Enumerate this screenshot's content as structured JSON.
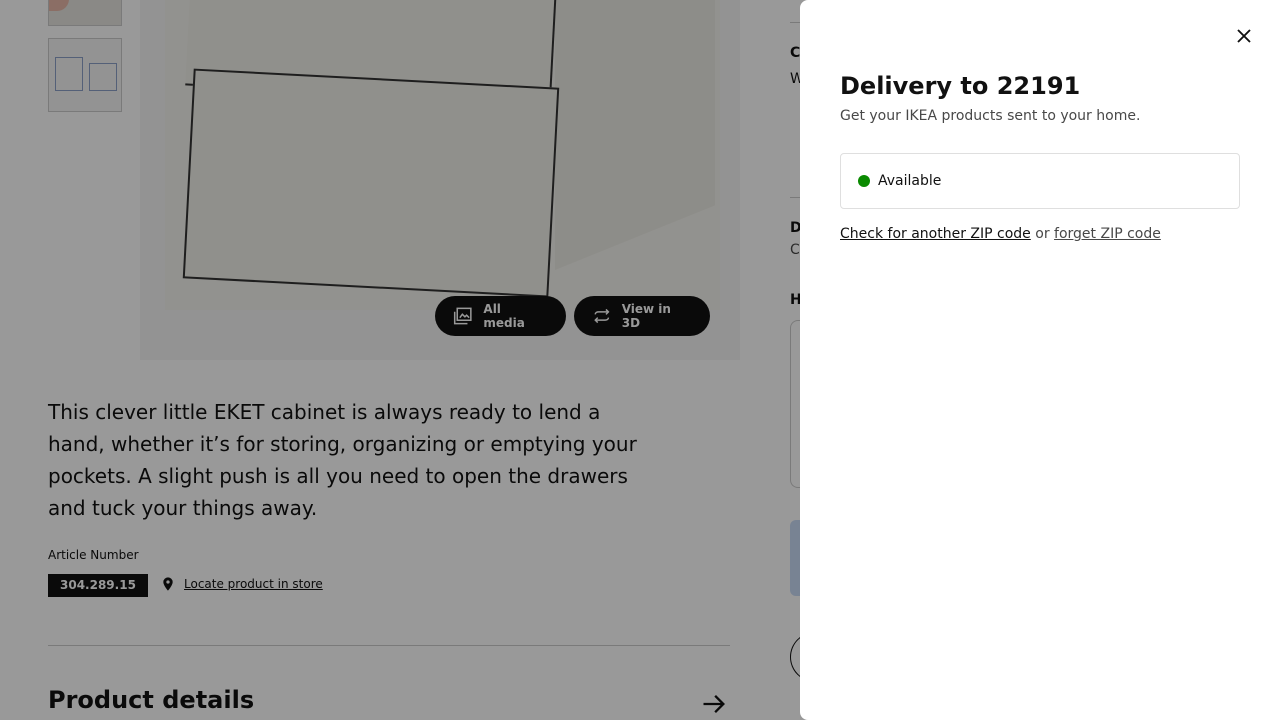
{
  "media": {
    "all_media_label": "All media",
    "view_3d_label": "View in 3D"
  },
  "product": {
    "description": "This clever little EKET cabinet is always ready to lend a hand, whether it’s for storing, organizing or emptying your pockets. A slight push is all you need to open the drawers and tuck your things away.",
    "article_label": "Article Number",
    "article_number": "304.289.15",
    "locate_label": "Locate product in store",
    "details_title": "Product details"
  },
  "side_column": {
    "c_letter": "C",
    "w_letter": "W",
    "d_letter": "D",
    "c2_letter": "C",
    "h_letter": "H"
  },
  "delivery_panel": {
    "title": "Delivery to 22191",
    "subtitle": "Get your IKEA products sent to your home.",
    "status": "Available",
    "status_color": "#0a8a00",
    "check_zip_label": "Check for another ZIP code",
    "or_text": "or",
    "forget_zip_label": "forget ZIP code"
  },
  "icons": {
    "close": "close-icon",
    "media": "image-stack-icon",
    "rotate": "rotate-3d-icon",
    "location": "location-pin-icon",
    "arrow": "arrow-right-icon"
  }
}
